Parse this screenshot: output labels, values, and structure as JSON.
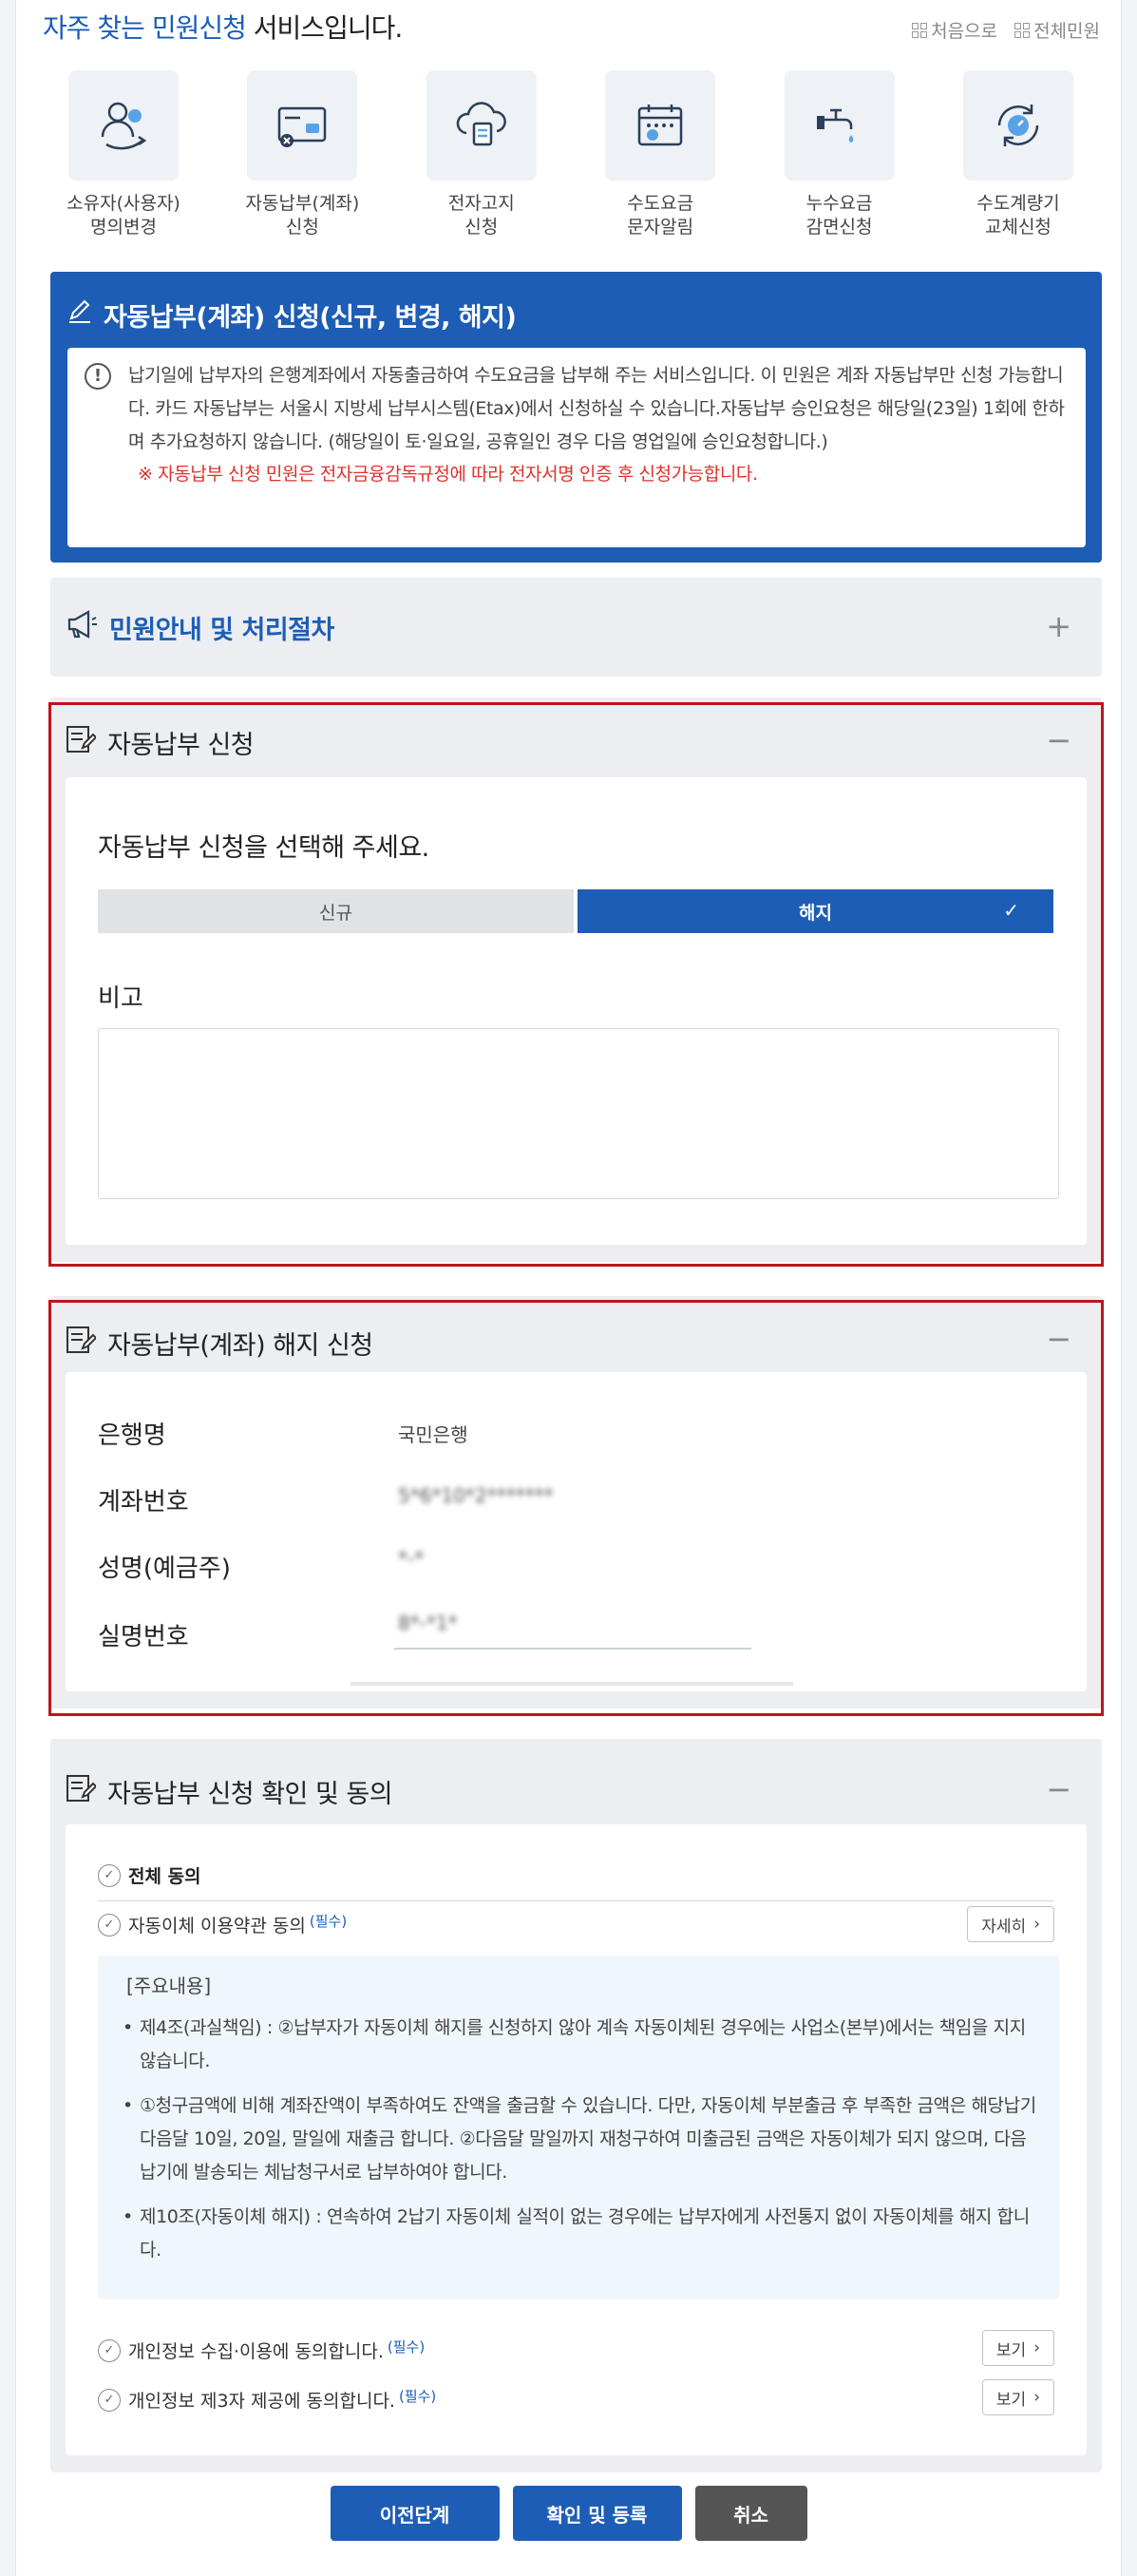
{
  "header": {
    "title_highlight": "자주 찾는 민원신청",
    "title_rest": " 서비스입니다.",
    "link_first": "처음으로",
    "link_all": "전체민원"
  },
  "services": [
    {
      "label": "소유자(사용자)\n명의변경",
      "icon": "person-swap-icon"
    },
    {
      "label": "자동납부(계좌)\n신청",
      "icon": "card-icon"
    },
    {
      "label": "전자고지\n신청",
      "icon": "cloud-document-icon"
    },
    {
      "label": "수도요금\n문자알림",
      "icon": "calendar-icon"
    },
    {
      "label": "누수요금\n감면신청",
      "icon": "faucet-icon"
    },
    {
      "label": "수도계량기\n교체신청",
      "icon": "meter-refresh-icon"
    }
  ],
  "notice": {
    "title": "자동납부(계좌) 신청(신규, 변경, 해지)",
    "desc": "납기일에 납부자의 은행계좌에서 자동출금하여 수도요금을 납부해 주는 서비스입니다. 이 민원은 계좌 자동납부만 신청 가능합니다. 카드 자동납부는 서울시 지방세 납부시스템(Etax)에서 신청하실 수 있습니다.자동납부 승인요청은 해당일(23일) 1회에 한하며 추가요청하지 않습니다. (해당일이 토·일요일, 공휴일인 경우 다음 영업일에 승인요청합니다.)",
    "warning": "※ 자동납부 신청 민원은 전자금융감독규정에 따라 전자서명 인증 후 신청가능합니다."
  },
  "guide": {
    "title": "민원안내 및 처리절차",
    "toggle": "+"
  },
  "apply": {
    "title": "자동납부 신청",
    "toggle": "−",
    "question": "자동납부 신청을 선택해 주세요.",
    "option_new": "신규",
    "option_cancel": "해지",
    "selected": "해지",
    "check_mark": "✓",
    "memo_label": "비고",
    "memo_value": ""
  },
  "cancel_info": {
    "title": "자동납부(계좌) 해지 신청",
    "toggle": "−",
    "bank_label": "은행명",
    "bank_value": "국민은행",
    "account_label": "계좌번호",
    "account_value": "5*6*10*2*******",
    "holder_label": "성명(예금주)",
    "holder_value": "*-*",
    "id_label": "실명번호",
    "id_value": "8*-*1*"
  },
  "agree": {
    "title": "자동납부 신청 확인 및 동의",
    "toggle": "−",
    "all_label": "전체 동의",
    "terms_label": "자동이체 이용약관 동의",
    "required": "(필수)",
    "detail_btn": "자세히",
    "terms_title": "[주요내용]",
    "terms_items": [
      "제4조(과실책임) : ②납부자가 자동이체 해지를 신청하지 않아 계속 자동이체된 경우에는 사업소(본부)에서는 책임을 지지 않습니다.",
      "①청구금액에 비해 계좌잔액이 부족하여도 잔액을 출금할 수 있습니다. 다만, 자동이체 부분출금 후 부족한 금액은 해당납기 다음달 10일, 20일, 말일에 재출금 합니다. ②다음달 말일까지 재청구하여 미출금된 금액은 자동이체가 되지 않으며, 다음 납기에 발송되는 체납청구서로 납부하여야 합니다.",
      "제10조(자동이체 해지) : 연속하여 2납기 자동이체 실적이 없는 경우에는 납부자에게 사전통지 없이 자동이체를 해지 합니다."
    ],
    "privacy_collect": "개인정보 수집·이용에 동의합니다.",
    "privacy_third": "개인정보 제3자 제공에 동의합니다.",
    "view_btn": "보기"
  },
  "buttons": {
    "prev": "이전단계",
    "confirm": "확인 및 등록",
    "cancel": "취소"
  }
}
